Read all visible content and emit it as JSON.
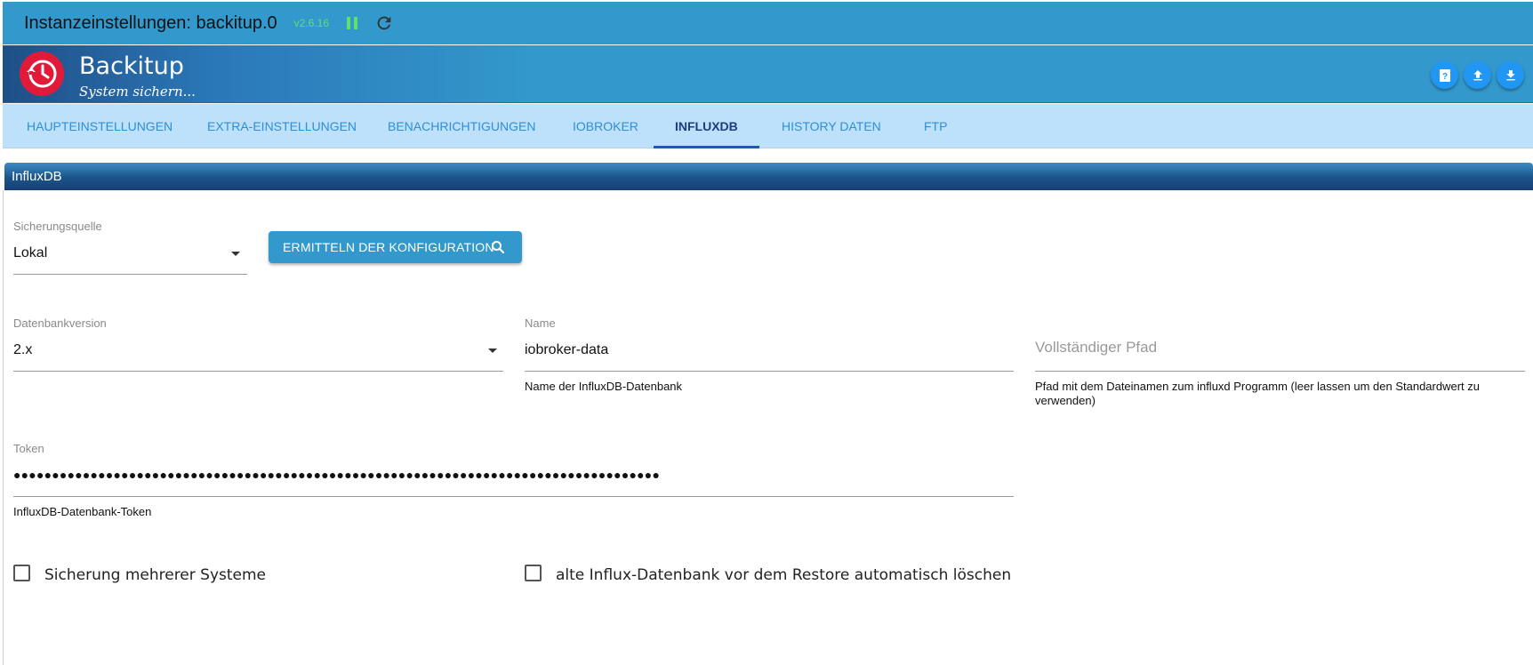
{
  "window": {
    "title": "Instanzeinstellungen: backitup.0",
    "version": "v2.6.16"
  },
  "header": {
    "app_name": "Backitup",
    "subtitle": "System sichern..."
  },
  "tabs": [
    {
      "label": "Haupteinstellungen"
    },
    {
      "label": "Extra-Einstellungen"
    },
    {
      "label": "Benachrichtigungen"
    },
    {
      "label": "ioBroker"
    },
    {
      "label": "InfluxDB"
    },
    {
      "label": "History Daten"
    },
    {
      "label": "FTP"
    }
  ],
  "active_tab": "InfluxDB",
  "panel": {
    "title": "InfluxDB"
  },
  "form": {
    "source": {
      "label": "Sicherungsquelle",
      "value": "Lokal"
    },
    "detect_button": "ERMITTELN DER KONFIGURATION",
    "db_version": {
      "label": "Datenbankversion",
      "value": "2.x"
    },
    "name": {
      "label": "Name",
      "value": "iobroker-data",
      "helper": "Name der InfluxDB-Datenbank"
    },
    "full_path": {
      "placeholder": "Vollständiger Pfad",
      "helper": "Pfad mit dem Dateinamen zum influxd Programm (leer lassen um den Standardwert zu verwenden)"
    },
    "token": {
      "label": "Token",
      "value": "●●●●●●●●●●●●●●●●●●●●●●●●●●●●●●●●●●●●●●●●●●●●●●●●●●●●●●●●●●●●●●●●●●●●●●●●●●●●●●●●●●●●",
      "helper": "InfluxDB-Datenbank-Token"
    },
    "multi_system": {
      "label": "Sicherung mehrerer Systeme",
      "checked": false
    },
    "auto_delete": {
      "label": "alte Influx-Datenbank vor dem Restore automatisch löschen",
      "checked": false
    }
  },
  "icons": {
    "pause": "pause-icon",
    "reload": "reload-icon",
    "logo": "backup-clock-icon",
    "help": "help-book-icon",
    "upload": "upload-icon",
    "download": "download-icon",
    "search": "search-icon"
  },
  "colors": {
    "accent": "#3399cc",
    "version_green": "#5fe06a",
    "logo_red": "#e11a3a",
    "tabs_bg": "#bde0fb",
    "active_tab": "#1a3f7a"
  }
}
